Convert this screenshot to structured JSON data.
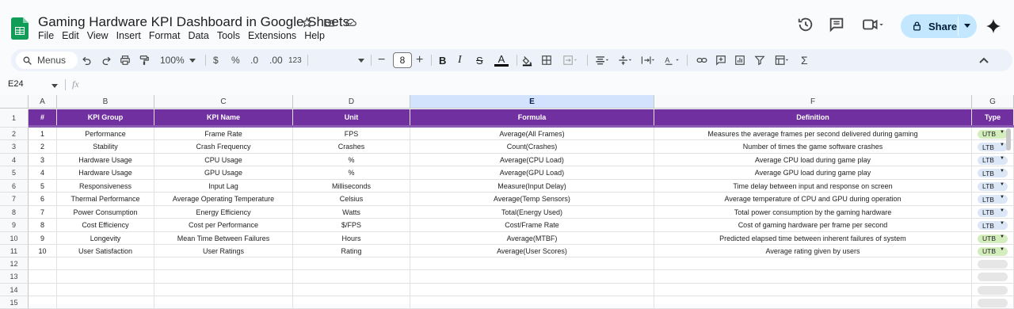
{
  "app": {
    "title": "Gaming Hardware KPI Dashboard in Google Sheets",
    "menu": [
      "File",
      "Edit",
      "View",
      "Insert",
      "Format",
      "Data",
      "Tools",
      "Extensions",
      "Help"
    ],
    "share_label": "Share"
  },
  "toolbar": {
    "menus_label": "Menus",
    "zoom": "100%",
    "currency": "$",
    "percent": "%",
    "dec_decrease": ".0",
    "dec_increase": ".00",
    "number_format": "123",
    "font_size": "8"
  },
  "formula_bar": {
    "name_box": "E24",
    "fx": "fx",
    "value": ""
  },
  "columns": [
    "A",
    "B",
    "C",
    "D",
    "E",
    "F",
    "G"
  ],
  "selected_column": "E",
  "header_row": {
    "row_number": "1",
    "cells": [
      "#",
      "KPI Group",
      "KPI Name",
      "Unit",
      "Formula",
      "Definition",
      "Type"
    ]
  },
  "rows": [
    {
      "row": "2",
      "cells": [
        "1",
        "Performance",
        "Frame Rate",
        "FPS",
        "Average(All Frames)",
        "Measures the average frames per second delivered during gaming"
      ],
      "type": "UTB"
    },
    {
      "row": "3",
      "cells": [
        "2",
        "Stability",
        "Crash Frequency",
        "Crashes",
        "Count(Crashes)",
        "Number of times the game software crashes"
      ],
      "type": "LTB"
    },
    {
      "row": "4",
      "cells": [
        "3",
        "Hardware Usage",
        "CPU Usage",
        "%",
        "Average(CPU Load)",
        "Average CPU load during game play"
      ],
      "type": "LTB"
    },
    {
      "row": "5",
      "cells": [
        "4",
        "Hardware Usage",
        "GPU Usage",
        "%",
        "Average(GPU Load)",
        "Average GPU load during game play"
      ],
      "type": "LTB"
    },
    {
      "row": "6",
      "cells": [
        "5",
        "Responsiveness",
        "Input Lag",
        "Milliseconds",
        "Measure(Input Delay)",
        "Time delay between input and response on screen"
      ],
      "type": "LTB"
    },
    {
      "row": "7",
      "cells": [
        "6",
        "Thermal Performance",
        "Average Operating Temperature",
        "Celsius",
        "Average(Temp Sensors)",
        "Average temperature of CPU and GPU during operation"
      ],
      "type": "LTB"
    },
    {
      "row": "8",
      "cells": [
        "7",
        "Power Consumption",
        "Energy Efficiency",
        "Watts",
        "Total(Energy Used)",
        "Total power consumption by the gaming hardware"
      ],
      "type": "LTB"
    },
    {
      "row": "9",
      "cells": [
        "8",
        "Cost Efficiency",
        "Cost per Performance",
        "$/FPS",
        "Cost/Frame Rate",
        "Cost of gaming hardware per frame per second"
      ],
      "type": "LTB"
    },
    {
      "row": "10",
      "cells": [
        "9",
        "Longevity",
        "Mean Time Between Failures",
        "Hours",
        "Average(MTBF)",
        "Predicted elapsed time between inherent failures of system"
      ],
      "type": "UTB"
    },
    {
      "row": "11",
      "cells": [
        "10",
        "User Satisfaction",
        "User Ratings",
        "Rating",
        "Average(User Scores)",
        "Average rating given by users"
      ],
      "type": "UTB"
    }
  ],
  "empty_rows": [
    "12",
    "13",
    "14",
    "15"
  ],
  "colors": {
    "header_purple": "#7030a0",
    "utb_chip": "#d4edbc",
    "ltb_chip": "#dbe6f7",
    "empty_chip": "#e6e6e6"
  }
}
